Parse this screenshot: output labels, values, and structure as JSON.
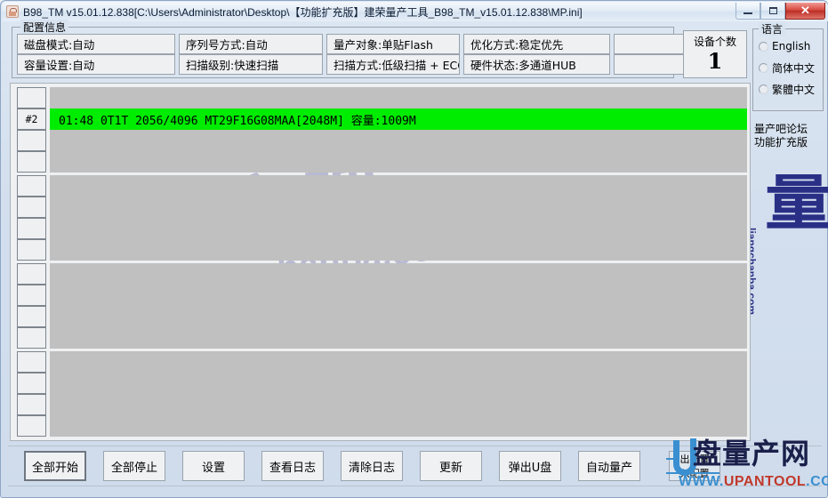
{
  "window": {
    "title": "B98_TM v15.01.12.838[C:\\Users\\Administrator\\Desktop\\【功能扩充版】建荣量产工具_B98_TM_v15.01.12.838\\MP.ini]",
    "app_icon": "flash-chip-icon",
    "buttons": {
      "minimize": "minimize-icon",
      "maximize": "maximize-icon",
      "close": "✕"
    }
  },
  "config": {
    "legend": "配置信息",
    "row1": [
      "磁盘模式:自动",
      "序列号方式:自动",
      "量产对象:单贴Flash",
      "优化方式:稳定优先"
    ],
    "row2": [
      "容量设置:自动",
      "扫描级别:快速扫描",
      "扫描方式:低级扫描 + ECC:",
      "硬件状态:多通道HUB"
    ]
  },
  "device_count": {
    "label": "设备个数",
    "value": "1"
  },
  "language": {
    "legend": "语言",
    "options": [
      {
        "label": "English",
        "selected": false
      },
      {
        "label": "简体中文",
        "selected": false
      },
      {
        "label": "繁體中文",
        "selected": false
      }
    ]
  },
  "forum_note": {
    "line1": "量产吧论坛",
    "line2": "功能扩充版"
  },
  "brand_logo": {
    "glyph": "量",
    "url": "liangchanba.com"
  },
  "watermark": {
    "cn": "量产吧",
    "url": "liangchanba.com"
  },
  "ports": [
    {
      "id": "",
      "text": "",
      "active": false
    },
    {
      "id": "#2",
      "text": "01:48 0T1T   2056/4096 MT29F16G08MAA[2048M]   容量:1009M",
      "active": true
    },
    {
      "id": "",
      "text": "",
      "active": false
    },
    {
      "id": "",
      "text": "",
      "active": false
    },
    {
      "id": "",
      "text": "",
      "active": false
    },
    {
      "id": "",
      "text": "",
      "active": false
    },
    {
      "id": "",
      "text": "",
      "active": false
    },
    {
      "id": "",
      "text": "",
      "active": false
    },
    {
      "id": "",
      "text": "",
      "active": false
    },
    {
      "id": "",
      "text": "",
      "active": false
    },
    {
      "id": "",
      "text": "",
      "active": false
    },
    {
      "id": "",
      "text": "",
      "active": false
    },
    {
      "id": "",
      "text": "",
      "active": false
    },
    {
      "id": "",
      "text": "",
      "active": false
    },
    {
      "id": "",
      "text": "",
      "active": false
    },
    {
      "id": "",
      "text": "",
      "active": false
    }
  ],
  "actions": [
    {
      "label": "全部开始",
      "primary": true
    },
    {
      "label": "全部停止",
      "primary": false
    },
    {
      "label": "设置",
      "primary": false
    },
    {
      "label": "查看日志",
      "primary": false
    },
    {
      "label": "清除日志",
      "primary": false
    },
    {
      "label": "更新",
      "primary": false
    },
    {
      "label": "弹出U盘",
      "primary": false
    },
    {
      "label": "自动量产",
      "primary": false
    }
  ],
  "config_io": {
    "export": "出配置",
    "import": "入配置"
  },
  "upan_watermark": {
    "cn": "盘量产网",
    "url_prefix": "WWW.",
    "url_mid": "UPANTOOL",
    "url_suffix": ".COM"
  },
  "colors": {
    "active_row": "#00ec00",
    "idle_row": "#c0c0c0",
    "brand": "#2a2f86",
    "accent_blue": "#3a8fd0",
    "close_red": "#bb2f26"
  }
}
